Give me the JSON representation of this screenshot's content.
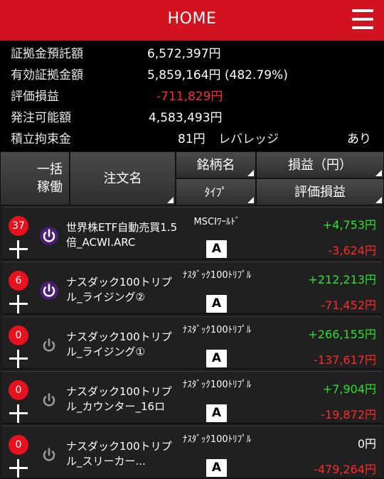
{
  "header": {
    "title": "HOME",
    "menu_icon": "hamburger-menu-icon"
  },
  "summary": {
    "deposit": {
      "label": "証拠金預託額",
      "value": "6,572,397円"
    },
    "effective": {
      "label": "有効証拠金額",
      "value": "5,859,164円 (482.79%)"
    },
    "valuation": {
      "label": "評価損益",
      "value": "-711,829円"
    },
    "orderable": {
      "label": "発注可能額",
      "value": "4,583,493円"
    },
    "margin": {
      "label": "積立拘束金",
      "value": "81円",
      "leverage_label": "レバレッジ",
      "leverage_value": "あり"
    }
  },
  "table_header": {
    "active": "一括\n稼働",
    "order_name": "注文名",
    "symbol": "銘柄名",
    "type": "ﾀｲﾌﾟ",
    "profit": "損益（円）",
    "eval": "評価損益"
  },
  "colors": {
    "accent_red": "#d2121f",
    "positive": "#2fe02f",
    "negative": "#ff2a2a",
    "power_on": "#8a3fd1"
  },
  "rows": [
    {
      "count": "37",
      "power": "on",
      "name": "世界株ETF自動売買1.5倍_ACWI.ARC",
      "symbol": "MSCIﾜｰﾙﾄﾞ",
      "type": "A",
      "profit": "+4,753円",
      "eval": "-3,624円"
    },
    {
      "count": "6",
      "power": "on",
      "name": "ナスダック100トリプル_ライジング②",
      "symbol": "ﾅｽﾀﾞｯｸ100ﾄﾘﾌﾟﾙ",
      "type": "A",
      "profit": "+212,213円",
      "eval": "-71,452円"
    },
    {
      "count": "0",
      "power": "off",
      "name": "ナスダック100トリプル_ライジング①",
      "symbol": "ﾅｽﾀﾞｯｸ100ﾄﾘﾌﾟﾙ",
      "type": "A",
      "profit": "+266,155円",
      "eval": "-137,617円"
    },
    {
      "count": "0",
      "power": "off",
      "name": "ナスダック100トリプル_カウンター_16ロ",
      "symbol": "ﾅｽﾀﾞｯｸ100ﾄﾘﾌﾟﾙ",
      "type": "A",
      "profit": "+7,904円",
      "eval": "-19,872円"
    },
    {
      "count": "0",
      "power": "off",
      "name": "ナスダック100トリプル_スリーカー...",
      "symbol": "ﾅｽﾀﾞｯｸ100ﾄﾘﾌﾟﾙ",
      "type": "A",
      "profit": "0円",
      "eval": "-479,264円"
    }
  ]
}
